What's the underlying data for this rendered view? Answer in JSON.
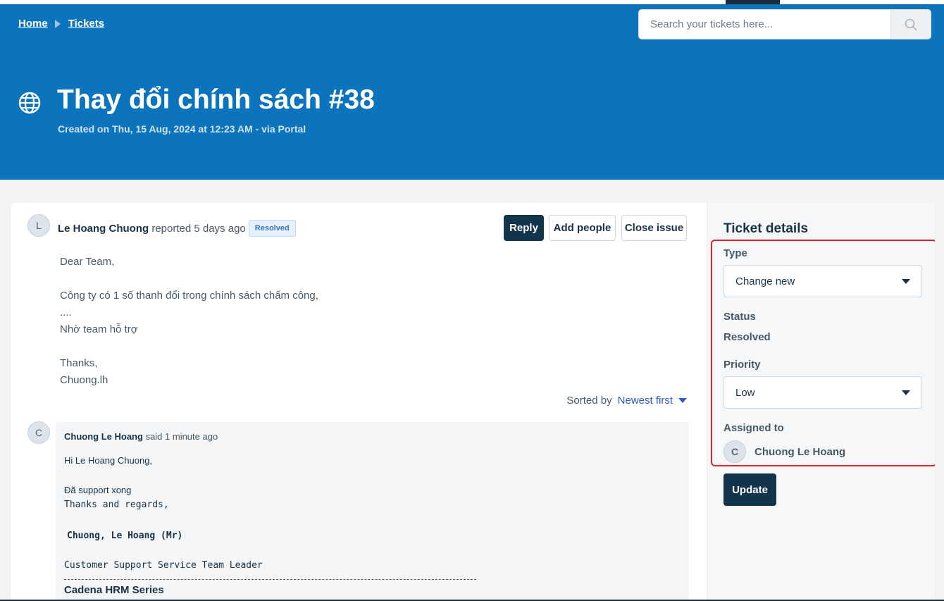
{
  "breadcrumb": {
    "home": "Home",
    "tickets": "Tickets"
  },
  "search": {
    "placeholder": "Search your tickets here..."
  },
  "ticket": {
    "title": "Thay đổi chính sách #38",
    "subtitle": "Created on Thu, 15 Aug, 2024 at 12:23 AM - via Portal"
  },
  "post": {
    "avatar": "L",
    "author": "Le Hoang Chuong",
    "action": "reported 5 days ago",
    "status_badge": "Resolved",
    "lines": [
      "Dear Team,",
      "",
      "Công ty có 1 số thanh đổi trong chính sách chấm công,",
      "....",
      "Nhờ team hỗ trợ",
      "",
      "Thanks,",
      "Chuong.lh"
    ]
  },
  "actions": {
    "reply": "Reply",
    "add_people": "Add people",
    "close_issue": "Close issue"
  },
  "sort": {
    "label": "Sorted by",
    "value": "Newest first"
  },
  "reply": {
    "avatar": "C",
    "author": "Chuong Le Hoang",
    "action": "said 1 minute ago",
    "greeting": "Hi Le Hoang Chuong,",
    "line1": "Đã support xong",
    "line2": "Thanks and regards,",
    "signature_name": "Chuong, Le Hoang (Mr)",
    "signature_role": "Customer Support Service Team Leader",
    "series": "Cadena HRM Series"
  },
  "sidebar": {
    "title": "Ticket details",
    "type_label": "Type",
    "type_value": "Change new",
    "status_label": "Status",
    "status_value": "Resolved",
    "priority_label": "Priority",
    "priority_value": "Low",
    "assigned_label": "Assigned to",
    "assignee_avatar": "C",
    "assignee_name": "Chuong Le Hoang",
    "update_button": "Update"
  },
  "colors": {
    "hero": "#0c74bc",
    "primary_button": "#12344d",
    "highlight": "#e02424",
    "link": "#2c5cc5"
  }
}
